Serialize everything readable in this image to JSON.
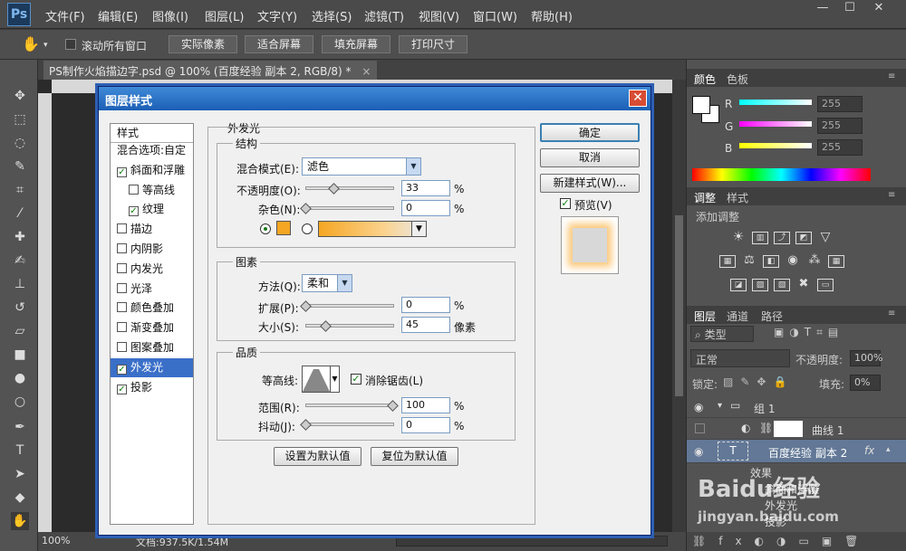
{
  "app": {
    "logo": "Ps"
  },
  "menu": [
    "文件(F)",
    "编辑(E)",
    "图像(I)",
    "图层(L)",
    "文字(Y)",
    "选择(S)",
    "滤镜(T)",
    "视图(V)",
    "窗口(W)",
    "帮助(H)"
  ],
  "window_controls": {
    "minimize": "—",
    "maximize": "☐",
    "close": "✕"
  },
  "options_bar": {
    "scroll_all_label": "滚动所有窗口",
    "actual_pixels": "实际像素",
    "fit_screen": "适合屏幕",
    "fill_screen": "填充屏幕",
    "print_size": "打印尺寸"
  },
  "document": {
    "tab_title": "PS制作火焰描边字.psd @ 100% (百度经验 副本 2, RGB/8) *",
    "tab_close": "×",
    "zoom": "100%",
    "doc_size": "文档:937.5K/1.54M"
  },
  "color_panel": {
    "tabs": [
      "颜色",
      "色板"
    ],
    "channels": [
      {
        "label": "R",
        "value": "255"
      },
      {
        "label": "G",
        "value": "255"
      },
      {
        "label": "B",
        "value": "255"
      }
    ]
  },
  "adjust_panel": {
    "tabs": [
      "调整",
      "样式"
    ],
    "add_label": "添加调整"
  },
  "layers_panel": {
    "tabs": [
      "图层",
      "通道",
      "路径"
    ],
    "filter_kind": "类型",
    "blend_mode": "正常",
    "opacity_label": "不透明度:",
    "opacity_value": "100%",
    "lock_label": "锁定:",
    "fill_label": "填充:",
    "fill_value": "0%",
    "layers": [
      {
        "name": "组 1"
      },
      {
        "name": "曲线 1"
      },
      {
        "name": "百度经验 副本 2",
        "fx": "fx"
      },
      {
        "name": "效果"
      },
      {
        "name": "斜面和浮雕"
      },
      {
        "name": "外发光"
      },
      {
        "name": "投影"
      }
    ]
  },
  "dialog": {
    "title": "图层样式",
    "close": "✕",
    "style_list": [
      {
        "label": "样式",
        "checkbox": false,
        "checked": false
      },
      {
        "label": "混合选项:自定",
        "checkbox": false,
        "checked": false
      },
      {
        "label": "斜面和浮雕",
        "checkbox": true,
        "checked": true
      },
      {
        "label": "等高线",
        "checkbox": true,
        "checked": false
      },
      {
        "label": "纹理",
        "checkbox": true,
        "checked": true
      },
      {
        "label": "描边",
        "checkbox": true,
        "checked": false
      },
      {
        "label": "内阴影",
        "checkbox": true,
        "checked": false
      },
      {
        "label": "内发光",
        "checkbox": true,
        "checked": false
      },
      {
        "label": "光泽",
        "checkbox": true,
        "checked": false
      },
      {
        "label": "颜色叠加",
        "checkbox": true,
        "checked": false
      },
      {
        "label": "渐变叠加",
        "checkbox": true,
        "checked": false
      },
      {
        "label": "图案叠加",
        "checkbox": true,
        "checked": false
      },
      {
        "label": "外发光",
        "checkbox": true,
        "checked": true
      },
      {
        "label": "投影",
        "checkbox": true,
        "checked": true
      }
    ],
    "section_title": "外发光",
    "structure": {
      "group": "结构",
      "blend_label": "混合模式(E):",
      "blend_value": "滤色",
      "opacity_label": "不透明度(O):",
      "opacity_value": "33",
      "noise_label": "杂色(N):",
      "noise_value": "0",
      "percent": "%",
      "glow_color": "#f5a623"
    },
    "elements": {
      "group": "图素",
      "method_label": "方法(Q):",
      "method_value": "柔和",
      "spread_label": "扩展(P):",
      "spread_value": "0",
      "size_label": "大小(S):",
      "size_value": "45",
      "pixels": "像素",
      "percent": "%"
    },
    "quality": {
      "group": "品质",
      "contour_label": "等高线:",
      "antialias_label": "消除锯齿(L)",
      "range_label": "范围(R):",
      "range_value": "100",
      "jitter_label": "抖动(J):",
      "jitter_value": "0",
      "percent": "%"
    },
    "buttons": {
      "ok": "确定",
      "cancel": "取消",
      "new_style": "新建样式(W)...",
      "preview": "预览(V)",
      "make_default": "设置为默认值",
      "reset_default": "复位为默认值"
    }
  },
  "watermark": {
    "line1": "Baidu经验",
    "line2": "jingyan.baidu.com"
  }
}
